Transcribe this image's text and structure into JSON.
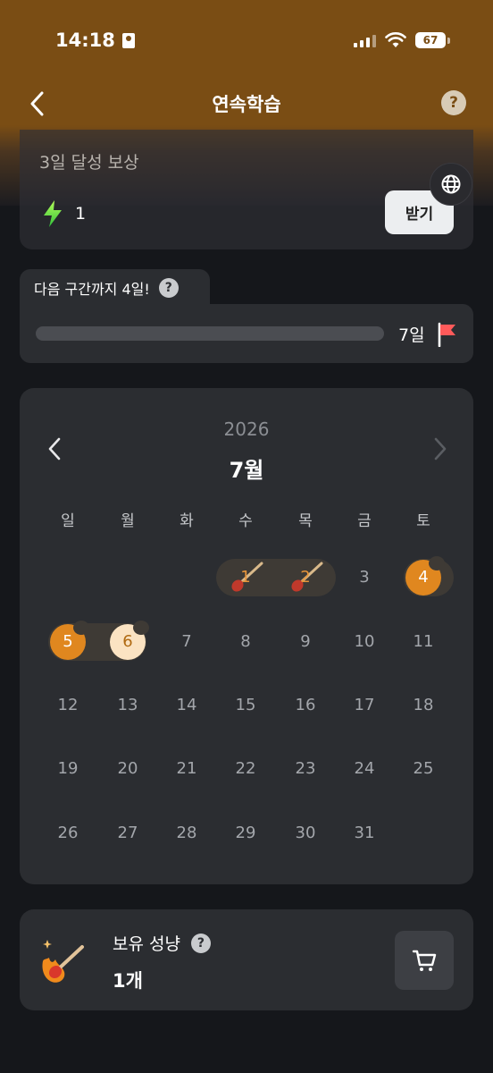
{
  "status_bar": {
    "time": "14:18",
    "battery": "67"
  },
  "nav": {
    "title": "연속학습"
  },
  "reward": {
    "title": "3일 달성 보상",
    "amount": "1",
    "receive_label": "받기"
  },
  "progress": {
    "next_text": "다음 구간까지 4일!",
    "goal_label": "7일",
    "value": 0
  },
  "calendar": {
    "year": "2026",
    "month": "7월",
    "weekdays": [
      "일",
      "월",
      "화",
      "수",
      "목",
      "금",
      "토"
    ],
    "days": [
      "1",
      "2",
      "3",
      "4",
      "5",
      "6",
      "7",
      "8",
      "9",
      "10",
      "11",
      "12",
      "13",
      "14",
      "15",
      "16",
      "17",
      "18",
      "19",
      "20",
      "21",
      "22",
      "23",
      "24",
      "25",
      "26",
      "27",
      "28",
      "29",
      "30",
      "31"
    ]
  },
  "owned": {
    "label": "보유 성냥",
    "count": "1개"
  },
  "colors": {
    "header": "#7a4d14",
    "flame": "#e0871f",
    "card": "#2b2d31",
    "flag": "#ff5a5a"
  }
}
